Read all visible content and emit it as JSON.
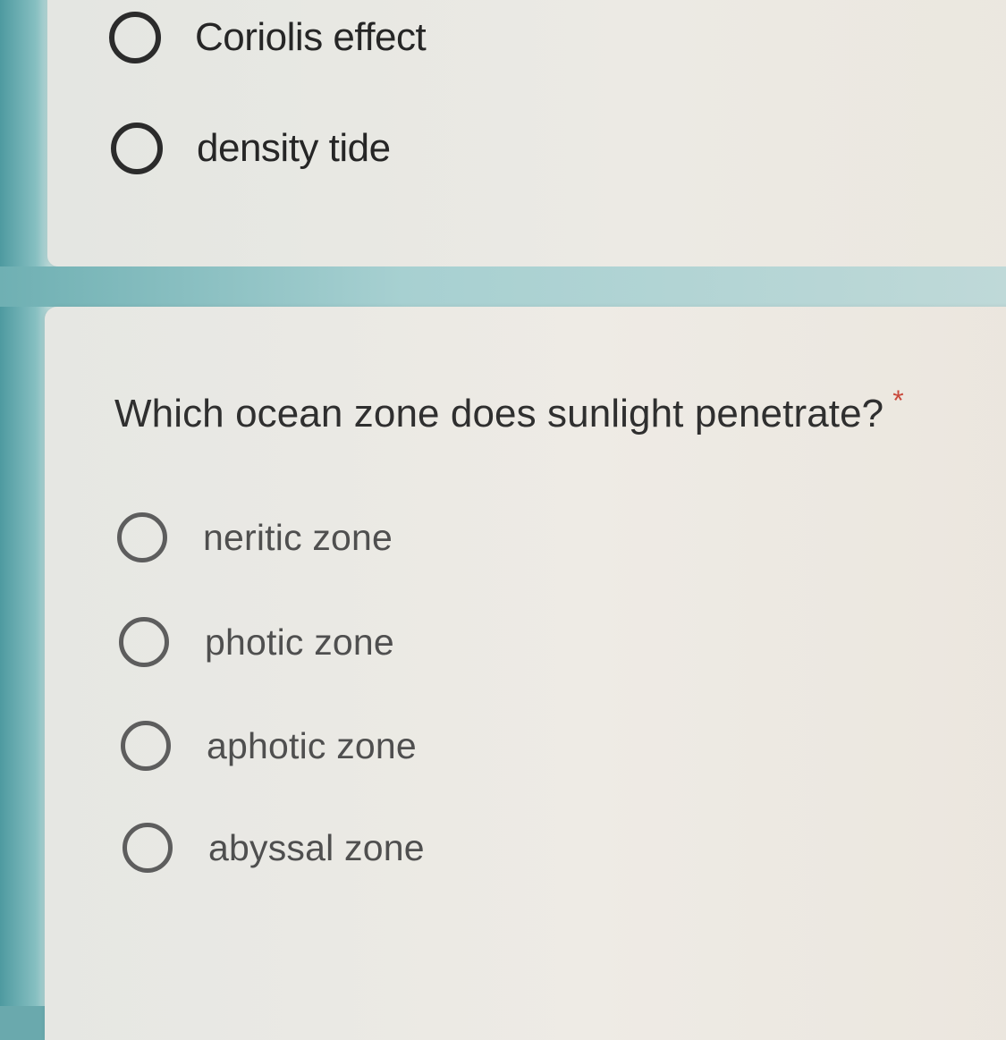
{
  "previous_question": {
    "options": [
      {
        "label": "Coriolis effect"
      },
      {
        "label": "density tide"
      }
    ]
  },
  "current_question": {
    "text": "Which ocean zone does sunlight penetrate?",
    "required_marker": "*",
    "options": [
      {
        "label": "neritic zone"
      },
      {
        "label": "photic zone"
      },
      {
        "label": "aphotic zone"
      },
      {
        "label": "abyssal zone"
      }
    ]
  },
  "colors": {
    "card": "#ebebe6",
    "background_band": "#7fb9bb",
    "required_marker": "#c94a3c",
    "radio_border": "#2b2b2b"
  }
}
